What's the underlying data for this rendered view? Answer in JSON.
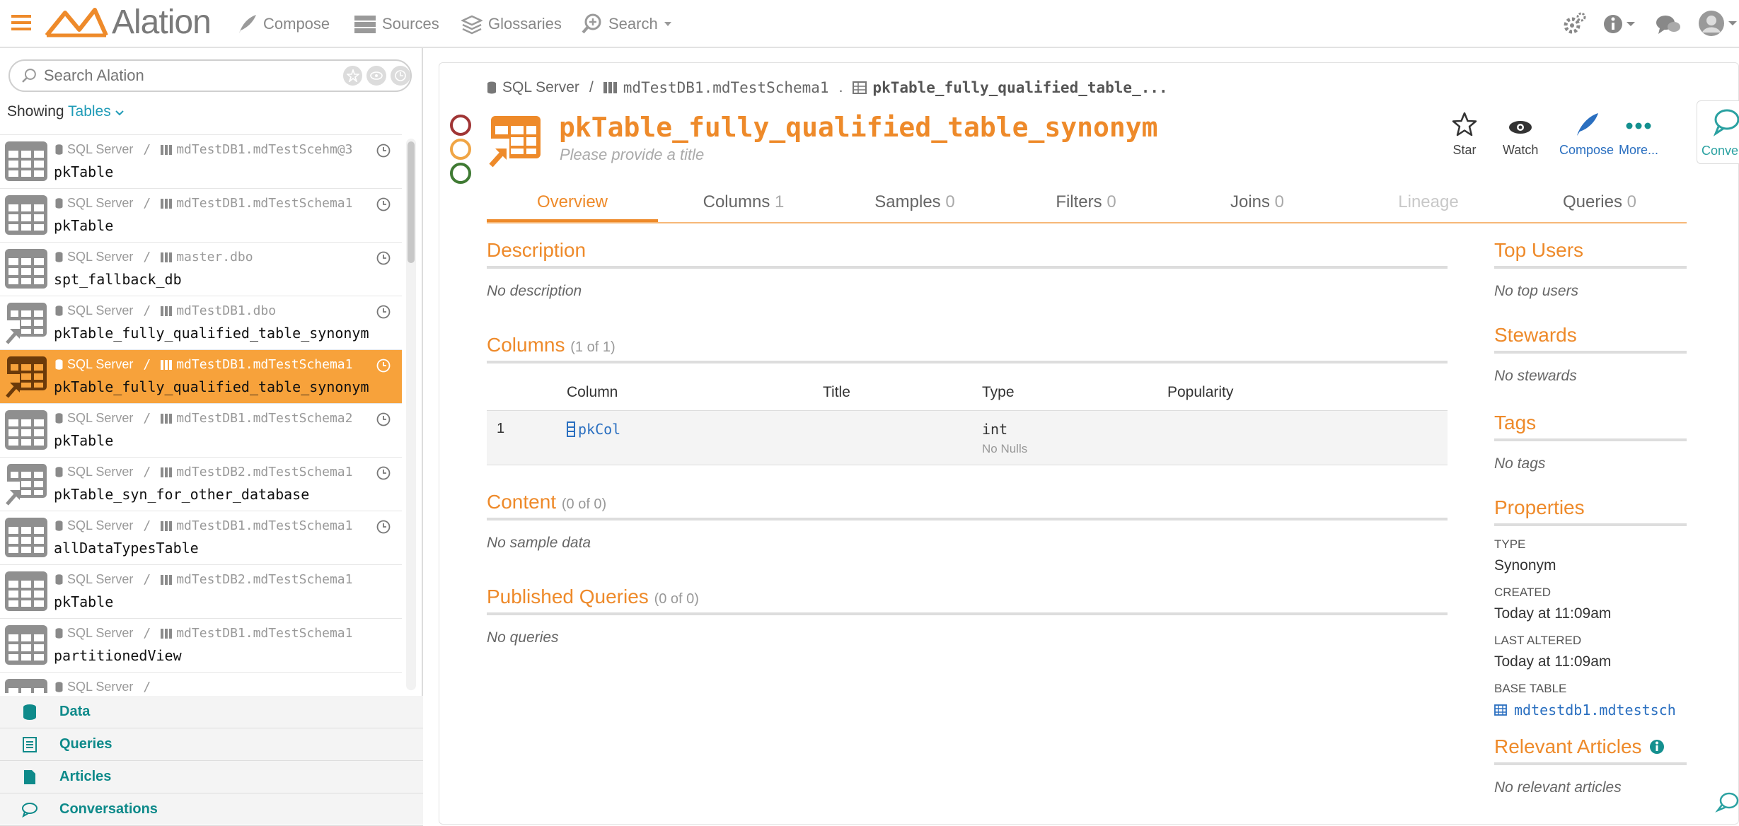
{
  "nav": {
    "logo": "Alation",
    "links": [
      {
        "label": "Compose",
        "icon": "quill-icon"
      },
      {
        "label": "Sources",
        "icon": "server-icon"
      },
      {
        "label": "Glossaries",
        "icon": "book-stack-icon"
      },
      {
        "label": "Search",
        "icon": "search-plus-icon"
      }
    ]
  },
  "sidebar": {
    "search_placeholder": "Search Alation",
    "showing_label": "Showing",
    "showing_value": "Tables",
    "items": [
      {
        "source": "SQL Server",
        "schema": "mdTestDB1.mdTestScehm@3",
        "name": "pkTable",
        "kind": "table"
      },
      {
        "source": "SQL Server",
        "schema": "mdTestDB1.mdTestSchema1",
        "name": "pkTable",
        "kind": "table"
      },
      {
        "source": "SQL Server",
        "schema": "master.dbo",
        "name": "spt_fallback_db",
        "kind": "table"
      },
      {
        "source": "SQL Server",
        "schema": "mdTestDB1.dbo",
        "name": "pkTable_fully_qualified_table_synonym",
        "kind": "synonym"
      },
      {
        "source": "SQL Server",
        "schema": "mdTestDB1.mdTestSchema1",
        "name": "pkTable_fully_qualified_table_synonym",
        "kind": "synonym",
        "selected": true
      },
      {
        "source": "SQL Server",
        "schema": "mdTestDB1.mdTestSchema2",
        "name": "pkTable",
        "kind": "table"
      },
      {
        "source": "SQL Server",
        "schema": "mdTestDB2.mdTestSchema1",
        "name": "pkTable_syn_for_other_database",
        "kind": "synonym"
      },
      {
        "source": "SQL Server",
        "schema": "mdTestDB1.mdTestSchema1",
        "name": "allDataTypesTable",
        "kind": "table"
      },
      {
        "source": "SQL Server",
        "schema": "mdTestDB2.mdTestSchema1",
        "name": "pkTable",
        "kind": "table",
        "noclock": true
      },
      {
        "source": "SQL Server",
        "schema": "mdTestDB1.mdTestSchema1",
        "name": "partitionedView",
        "kind": "table",
        "noclock": true
      },
      {
        "source": "SQL Server",
        "schema": "",
        "name": "",
        "kind": "table",
        "noclock": true
      }
    ],
    "bottom_nav": [
      "Data",
      "Queries",
      "Articles",
      "Conversations"
    ]
  },
  "breadcrumb": {
    "source": "SQL Server",
    "schema": "mdTestDB1.mdTestSchema1",
    "table": "pkTable_fully_qualified_table_..."
  },
  "object": {
    "title": "pkTable_fully_qualified_table_synonym",
    "subtitle": "Please provide a title"
  },
  "actions": [
    "Star",
    "Watch",
    "Compose",
    "More..."
  ],
  "conversation_tab": "Conver",
  "tabs": [
    {
      "label": "Overview",
      "count": ""
    },
    {
      "label": "Columns",
      "count": "1"
    },
    {
      "label": "Samples",
      "count": "0"
    },
    {
      "label": "Filters",
      "count": "0"
    },
    {
      "label": "Joins",
      "count": "0"
    },
    {
      "label": "Lineage",
      "count": ""
    },
    {
      "label": "Queries",
      "count": "0"
    }
  ],
  "description": {
    "title": "Description",
    "empty": "No description"
  },
  "columns": {
    "title": "Columns",
    "count": "(1 of 1)",
    "headers": [
      "Column",
      "Title",
      "Type",
      "Popularity"
    ],
    "rows": [
      {
        "index": "1",
        "name": "pkCol",
        "title": "",
        "type": "int",
        "note": "No Nulls"
      }
    ]
  },
  "content": {
    "title": "Content",
    "count": "(0 of 0)",
    "empty": "No sample data"
  },
  "published": {
    "title": "Published Queries",
    "count": "(0 of 0)",
    "empty": "No queries"
  },
  "side": {
    "top_users": {
      "title": "Top Users",
      "empty": "No top users"
    },
    "stewards": {
      "title": "Stewards",
      "empty": "No stewards"
    },
    "tags": {
      "title": "Tags",
      "empty": "No tags"
    },
    "properties": {
      "title": "Properties",
      "type_label": "TYPE",
      "type_value": "Synonym",
      "created_label": "CREATED",
      "created_value": "Today at 11:09am",
      "altered_label": "LAST ALTERED",
      "altered_value": "Today at 11:09am",
      "base_label": "BASE TABLE",
      "base_value": "mdtestdb1.mdtestsch"
    },
    "articles": {
      "title": "Relevant Articles",
      "empty": "No relevant articles"
    }
  },
  "colors": {
    "accent": "#ee8a2a",
    "selected": "#f7a23b",
    "teal": "#1f9bb7",
    "link": "#2a6fc0"
  }
}
